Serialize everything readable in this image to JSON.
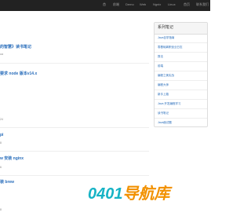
{
  "topnav": {
    "items": [
      "首",
      "前端",
      "Demo",
      "Web",
      "Ngnix",
      "Linux",
      "首页",
      "联系我们"
    ]
  },
  "posts": [
    {
      "title": "的智慧》读书笔记",
      "meta": "ua"
    },
    {
      "title": "要求 node 版本v14.x",
      "meta": ""
    },
    {
      "title": "",
      "meta": "24"
    },
    {
      "title": "pi",
      "meta": "8"
    },
    {
      "title": "w 安装 nginx",
      "meta": "6"
    },
    {
      "title": "装 brew",
      "meta": ""
    }
  ],
  "bottom_meta": "8",
  "sidebar": {
    "title": "系列笔记",
    "items": [
      "Java自学指南",
      "零基础离职创业日志",
      "算法",
      "前端",
      "编程之美实战",
      "编程大师",
      "新手上路",
      "Java 开发编程学习",
      "读书笔记",
      "Java面试题"
    ]
  },
  "watermark": {
    "digits": "0401",
    "text": "导航库"
  }
}
